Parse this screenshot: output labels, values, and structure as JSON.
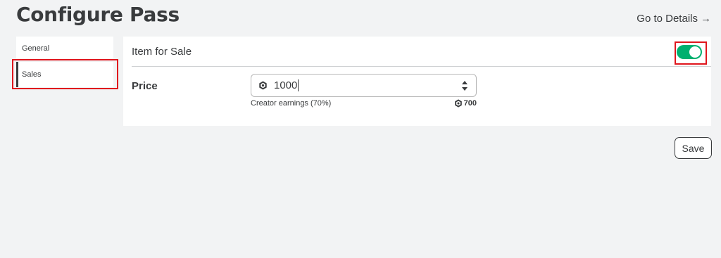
{
  "header": {
    "title": "Configure Pass",
    "details_link": "Go to Details",
    "details_arrow": "→"
  },
  "sidebar": {
    "items": [
      {
        "label": "General",
        "active": false
      },
      {
        "label": "Sales",
        "active": true
      }
    ]
  },
  "sales": {
    "item_for_sale_label": "Item for Sale",
    "item_for_sale_enabled": true,
    "price_label": "Price",
    "price_value": "1000",
    "currency_icon": "robux-icon",
    "earnings_label": "Creator earnings (70%)",
    "earnings_amount": "700"
  },
  "actions": {
    "save_label": "Save"
  },
  "colors": {
    "toggle_on": "#00b06f",
    "highlight": "#e0161d",
    "text": "#393b3d"
  }
}
